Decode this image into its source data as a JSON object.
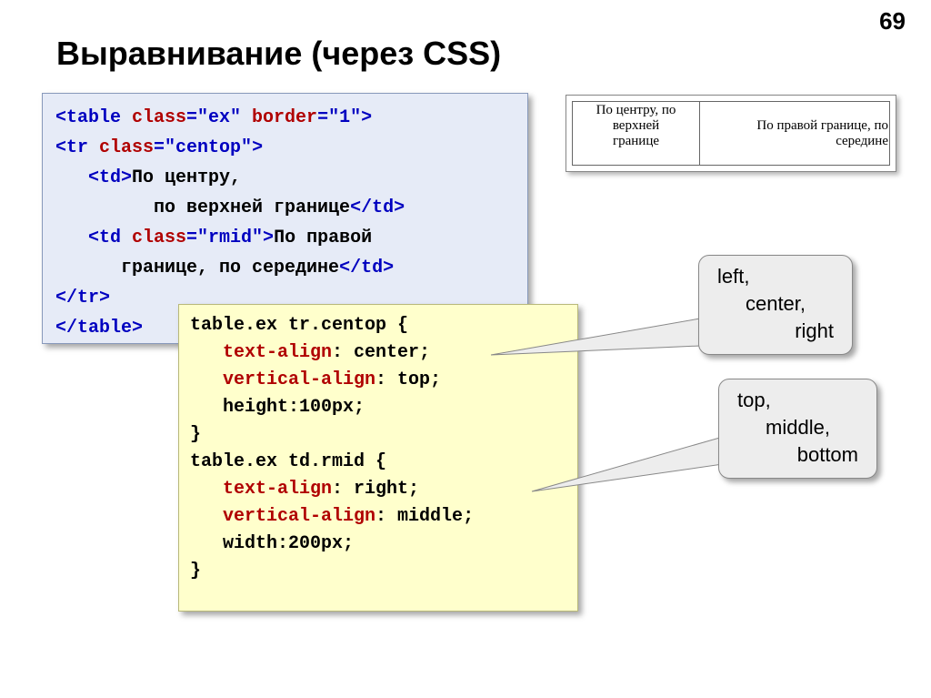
{
  "pageNumber": "69",
  "title": "Выравнивание (через CSS)",
  "htmlCode": {
    "l1": {
      "open": "<table ",
      "a1": "class",
      "v1": "=\"ex\" ",
      "a2": "border",
      "v2": "=\"1\"",
      "close": ">"
    },
    "l2": {
      "open": "<tr ",
      "a1": "class",
      "v1": "=\"centop\"",
      "close": ">"
    },
    "l3_open": "   <td>",
    "l3_text": "По центру,",
    "l4_text": "         по верхней границе",
    "l4_close": "</td>",
    "l5_open": "   <td ",
    "l5_a1": "class",
    "l5_v1": "=\"rmid\"",
    "l5_close": ">",
    "l5_text": "По правой",
    "l6_text": "      границе, по середине",
    "l6_close": "</td>",
    "l7": "</tr>",
    "l8": "</table>"
  },
  "cssCode": {
    "s1_sel": "table.ex tr.centop {",
    "s1_p1": "   text-align",
    "s1_v1": ": center;",
    "s1_p2": "   vertical-align",
    "s1_v2": ": top;",
    "s1_p3": "   height:100px;",
    "s1_end": "}",
    "s2_sel": "table.ex td.rmid {",
    "s2_p1": "   text-align",
    "s2_v1": ": right;",
    "s2_p2": "   vertical-align",
    "s2_v2": ": middle;",
    "s2_p3": "   width:200px;",
    "s2_end": "}"
  },
  "preview": {
    "cell1_l1": "По центру, по",
    "cell1_l2": "верхней",
    "cell1_l3": "границе",
    "cell2_l1": "По правой границе, по",
    "cell2_l2": "середине"
  },
  "bubble1": {
    "l1": "left,",
    "l2": "center,",
    "l3": "right"
  },
  "bubble2": {
    "l1": "top,",
    "l2": "middle,",
    "l3": "bottom"
  }
}
